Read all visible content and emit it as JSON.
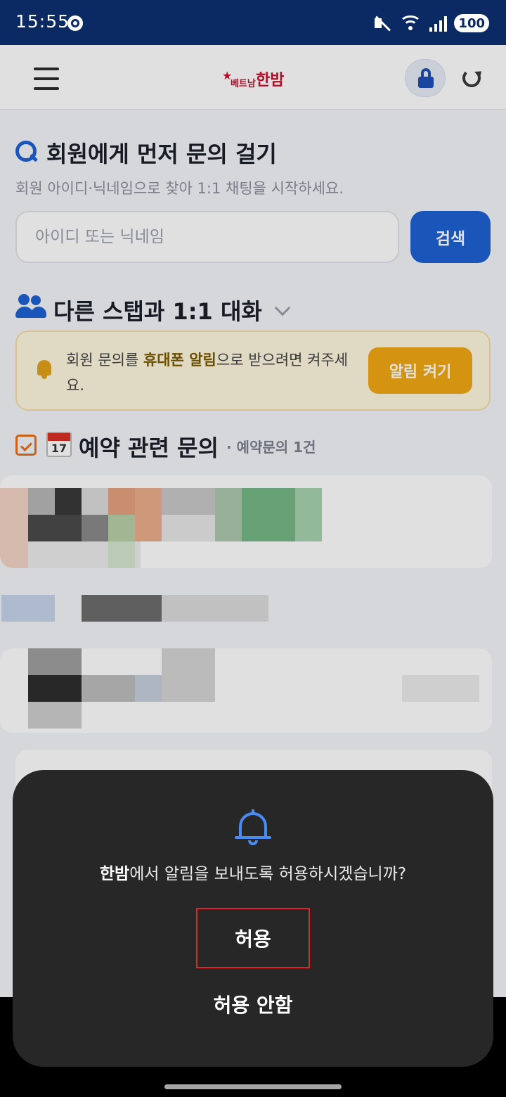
{
  "status_bar": {
    "time": "15:55",
    "battery": "100"
  },
  "header": {
    "logo_main": "한밤",
    "logo_sub": "베트남"
  },
  "search_section": {
    "title": "회원에게 먼저 문의 걸기",
    "subtitle": "회원 아이디·닉네임으로 찾아 1:1 채팅을 시작하세요.",
    "placeholder": "아이디 또는 닉네임",
    "button": "검색"
  },
  "chat_section": {
    "title": "다른 스탭과 1:1 대화",
    "notice_pre": "회원 문의를 ",
    "notice_bold": "휴대폰 알림",
    "notice_post": "으로 받으려면 켜주세요.",
    "notice_button": "알림 켜기"
  },
  "reservation_section": {
    "calendar_day": "17",
    "title": "예약 관련 문의",
    "count": "· 예약문의 1건"
  },
  "dialog": {
    "app_name": "한밤",
    "message": "에서 알림을 보내도록 허용하시겠습니까?",
    "allow": "허용",
    "deny": "허용 안함"
  },
  "colors": {
    "accent": "#1e62d4",
    "warning": "#f2a813",
    "dialog_bg": "#272727",
    "highlight": "#e0262b"
  }
}
